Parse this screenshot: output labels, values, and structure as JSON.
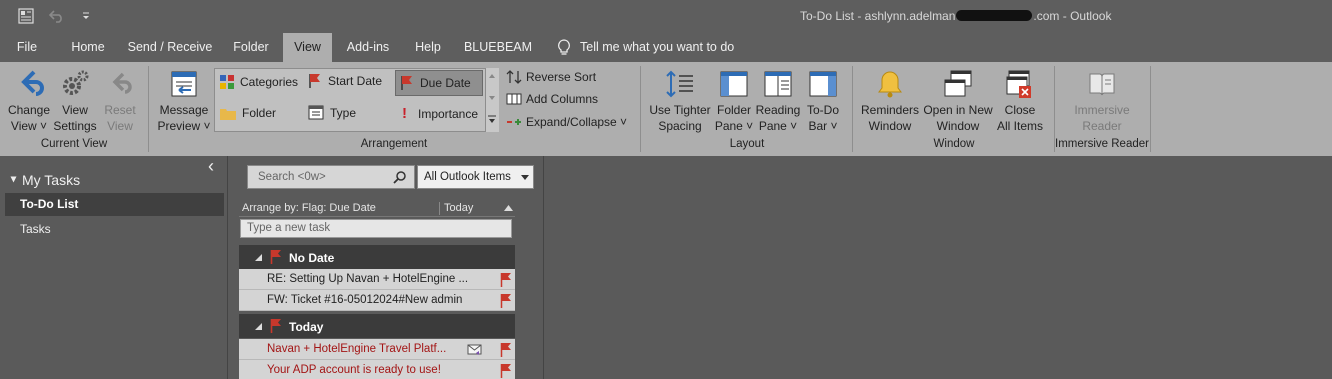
{
  "window": {
    "title_prefix": "To-Do List - ashlynn.adelman",
    "title_suffix": ".com  -  Outlook"
  },
  "tabs": [
    {
      "label": "File"
    },
    {
      "label": "Home"
    },
    {
      "label": "Send / Receive"
    },
    {
      "label": "Folder"
    },
    {
      "label": "View",
      "active": true
    },
    {
      "label": "Add-ins"
    },
    {
      "label": "Help"
    },
    {
      "label": "BLUEBEAM"
    }
  ],
  "tell_me": "Tell me what you want to do",
  "ribbon": {
    "current_view": {
      "group_label": "Current View",
      "change_view": "Change\nView ˅",
      "view_settings": "View\nSettings",
      "reset_view": "Reset\nView"
    },
    "arrangement": {
      "group_label": "Arrangement",
      "message_preview": "Message\nPreview ˅",
      "categories": "Categories",
      "start_date": "Start Date",
      "due_date": "Due Date",
      "folder": "Folder",
      "type": "Type",
      "importance": "Importance",
      "reverse_sort": "Reverse Sort",
      "add_columns": "Add Columns",
      "expand_collapse": "Expand/Collapse ˅"
    },
    "layout": {
      "group_label": "Layout",
      "use_tighter_spacing": "Use Tighter\nSpacing",
      "folder_pane": "Folder\nPane ˅",
      "reading_pane": "Reading\nPane ˅",
      "todo_bar": "To-Do\nBar ˅"
    },
    "window": {
      "group_label": "Window",
      "reminders_window": "Reminders\nWindow",
      "open_in_new_window": "Open in New\nWindow",
      "close_all_items": "Close\nAll Items"
    },
    "immersive_reader": {
      "group_label": "Immersive Reader",
      "immersive_reader": "Immersive\nReader"
    }
  },
  "nav": {
    "collapse_glyph": "‹",
    "section": "My Tasks",
    "items": [
      {
        "label": "To-Do List",
        "selected": true
      },
      {
        "label": "Tasks",
        "selected": false
      }
    ]
  },
  "list": {
    "search_placeholder": "Search <0w>",
    "scope": "All Outlook Items",
    "arrange_by": "Arrange by: Flag: Due Date",
    "arrange_today": "Today",
    "new_task_placeholder": "Type a new task",
    "groups": [
      {
        "label": "No Date",
        "items": [
          {
            "subject": "RE: Setting Up Navan + HotelEngine ...",
            "overdue": false
          },
          {
            "subject": "FW: Ticket #16-05012024#New admin",
            "overdue": false
          }
        ]
      },
      {
        "label": "Today",
        "items": [
          {
            "subject": "Navan + HotelEngine Travel Platf...",
            "overdue": true
          },
          {
            "subject": "Your ADP account is ready to use!",
            "overdue": true
          }
        ]
      }
    ]
  },
  "colors": {
    "flag_red": "#c8382c",
    "overdue_text": "#a31515",
    "ribbon_bg": "#aeaeae",
    "chrome_bg": "#5e5e5e"
  }
}
